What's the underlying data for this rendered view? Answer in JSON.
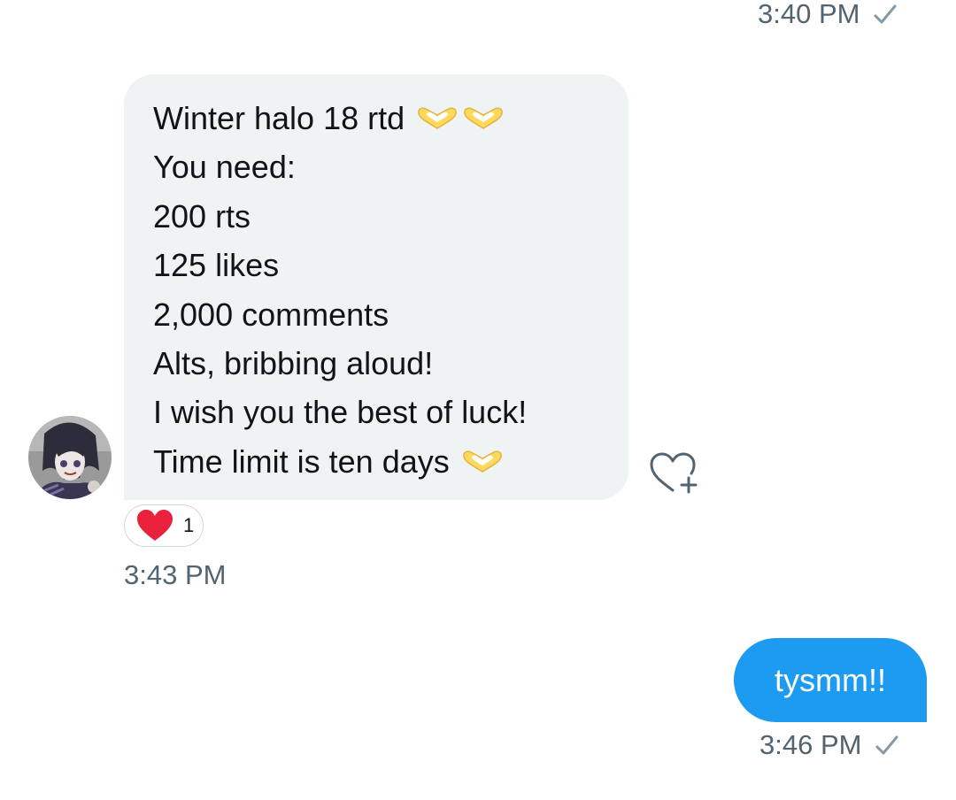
{
  "thread": {
    "top_timestamp": "3:40 PM",
    "incoming": {
      "lines": [
        "Winter halo 18 rtd",
        "You need:",
        "200 rts",
        "125 likes",
        "2,000 comments",
        "Alts, bribbing aloud!",
        "I wish you the best of luck!",
        "Time limit is ten days"
      ],
      "reaction_count": "1",
      "timestamp": "3:43 PM"
    },
    "outgoing": {
      "text": "tysmm!!",
      "timestamp": "3:46 PM"
    }
  },
  "icons": {
    "read_check": "check-icon",
    "heart_hands_emoji": "heart-hands-icon",
    "add_reaction": "heart-plus-icon",
    "reaction_heart": "red-heart-icon"
  },
  "colors": {
    "incoming_bubble": "#eff3f4",
    "outgoing_bubble": "#1d9bf0",
    "timestamp": "#536471",
    "reaction_heart": "#e8223d",
    "heart_hands": "#ffd85e"
  }
}
